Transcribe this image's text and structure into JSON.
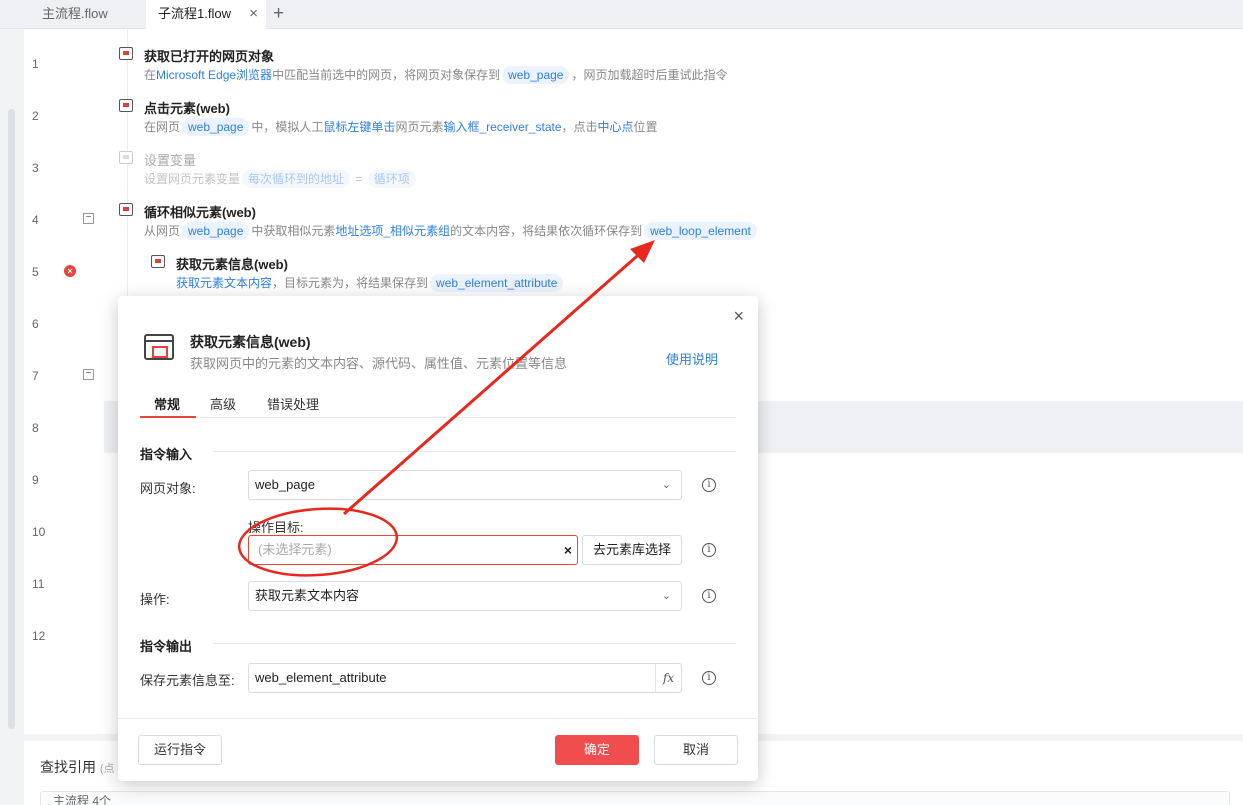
{
  "tabs": [
    {
      "label": "主流程.flow"
    },
    {
      "label": "子流程1.flow",
      "close": "×"
    }
  ],
  "tab_add": "+",
  "line_numbers": [
    "1",
    "2",
    "3",
    "4",
    "5",
    "6",
    "7",
    "8",
    "9",
    "10",
    "11",
    "12"
  ],
  "fold_symbol": "−",
  "steps": {
    "s1": {
      "title": "获取已打开的网页对象",
      "d1": "在",
      "d2": "Microsoft Edge浏览器",
      "d3": "中匹配当前选中的网页，将网页对象保存到",
      "chip": "web_page",
      "d4": "，网页加载超时后重试此指令"
    },
    "s2": {
      "title": "点击元素(web)",
      "d1": "在网页",
      "chip": "web_page",
      "d2": "中，模拟人工",
      "d3": "鼠标左键单击",
      "d4": "网页元素",
      "d5": "输入框_receiver_state",
      "d6": "，点击",
      "d7": "中心点",
      "d8": "位置"
    },
    "s3": {
      "title": "设置变量",
      "d1": "设置网页元素变量",
      "chip1": "每次循环到的地址",
      "d2": "=",
      "chip2": "循环项"
    },
    "s4": {
      "title": "循环相似元素(web)",
      "d1": "从网页",
      "chip1": "web_page",
      "d2": "中获取相似元素",
      "d3": "地址选项_相似元素组",
      "d4": "的文本内容，将结果依次循环保存到",
      "chip2": "web_loop_element"
    },
    "s5": {
      "title": "获取元素信息(web)",
      "d1": "获取元素文本内容",
      "d2": "，目标元素为，将结果保存到",
      "chip": "web_element_attribute"
    }
  },
  "error_mark": "×",
  "bottom": {
    "title": "查找引用",
    "title_hint": "(点",
    "row": "主流程 4个"
  },
  "modal": {
    "close": "×",
    "title": "获取元素信息(web)",
    "subtitle": "获取网页中的元素的文本内容、源代码、属性值、元素位置等信息",
    "help": "使用说明",
    "tabs": [
      "常规",
      "高级",
      "错误处理"
    ],
    "section_input": "指令输入",
    "web_object_label": "网页对象:",
    "web_object_value": "web_page",
    "target_label": "操作目标:",
    "target_placeholder": "(未选择元素)",
    "target_clear": "×",
    "lib_button": "去元素库选择",
    "operation_label": "操作:",
    "operation_value": "获取元素文本内容",
    "section_output": "指令输出",
    "save_label": "保存元素信息至:",
    "save_value": "web_element_attribute",
    "fx": "fx",
    "info": "i",
    "caret": "⌄",
    "run_button": "运行指令",
    "ok_button": "确定",
    "cancel_button": "取消"
  },
  "annotation_color": "#e8281e"
}
